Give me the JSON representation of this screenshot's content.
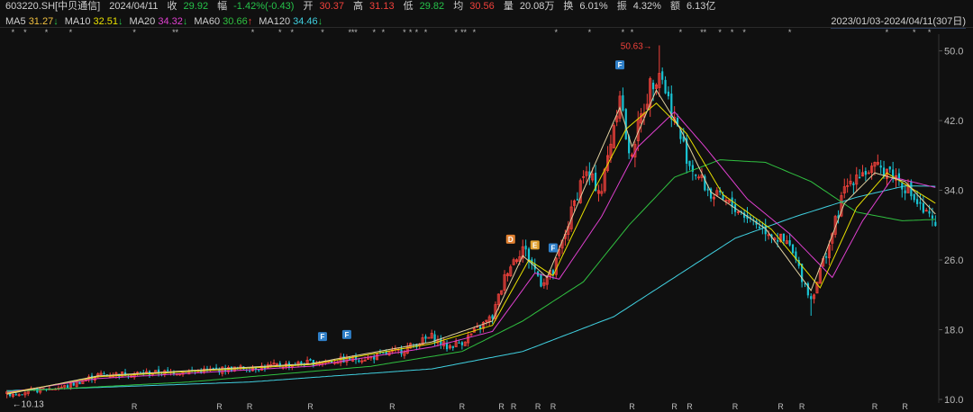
{
  "header": {
    "symbol": "603220.SH[中贝通信]",
    "date": "2024/04/11",
    "close_label": "收",
    "close": "29.92",
    "change_label": "幅",
    "change": "-1.42%(-0.43)",
    "open_label": "开",
    "open": "30.37",
    "high_label": "高",
    "high": "31.13",
    "low_label": "低",
    "low": "29.82",
    "avg_label": "均",
    "avg": "30.56",
    "vol_label": "量",
    "vol": "20.08万",
    "turn_label": "换",
    "turn": "6.01%",
    "amp_label": "振",
    "amp": "4.32%",
    "amt_label": "额",
    "amt": "6.13亿"
  },
  "ma_legend": [
    {
      "label": "MA5",
      "value": "31.27",
      "arrow": "↓",
      "color": "#f0c040"
    },
    {
      "label": "MA10",
      "value": "32.51",
      "arrow": "↓",
      "color": "#e8e000"
    },
    {
      "label": "MA20",
      "value": "34.32",
      "arrow": "↓",
      "color": "#e040d0"
    },
    {
      "label": "MA60",
      "value": "30.66",
      "arrow": "↑",
      "color": "#30c040"
    },
    {
      "label": "MA120",
      "value": "34.46",
      "arrow": "↓",
      "color": "#40d0e0"
    }
  ],
  "date_range": "2023/01/03-2024/04/11(307日)",
  "colors": {
    "up": "#f0413b",
    "down": "#19c3d3",
    "ma5": "#e0d0a0",
    "ma10": "#e8e000",
    "ma20": "#e040d0",
    "ma60": "#30c040",
    "ma120": "#40d0e0"
  },
  "chart_data": {
    "type": "candlestick",
    "ylim": [
      10,
      51.5
    ],
    "yticks": [
      "50.0",
      "42.0",
      "34.0",
      "26.0",
      "18.0",
      "10.0"
    ],
    "ytick_values": [
      50,
      42,
      34,
      26,
      18,
      10
    ],
    "max_label": "50.63",
    "min_label": "10.13",
    "anchors": [
      [
        0,
        10.6
      ],
      [
        20,
        11.5
      ],
      [
        30,
        12.8
      ],
      [
        60,
        13.2
      ],
      [
        80,
        13.6
      ],
      [
        100,
        14.2
      ],
      [
        120,
        14.8
      ],
      [
        130,
        15.6
      ],
      [
        140,
        17.2
      ],
      [
        145,
        16.0
      ],
      [
        150,
        16.6
      ],
      [
        160,
        19.5
      ],
      [
        165,
        25.0
      ],
      [
        170,
        27.5
      ],
      [
        176,
        23.5
      ],
      [
        180,
        24.5
      ],
      [
        190,
        36.0
      ],
      [
        196,
        34.0
      ],
      [
        202,
        45.5
      ],
      [
        205,
        37.5
      ],
      [
        212,
        46.0
      ],
      [
        215,
        48.0
      ],
      [
        220,
        42.0
      ],
      [
        225,
        37.0
      ],
      [
        232,
        33.5
      ],
      [
        240,
        32.0
      ],
      [
        250,
        29.5
      ],
      [
        258,
        27.5
      ],
      [
        265,
        21.5
      ],
      [
        272,
        29.0
      ],
      [
        276,
        34.0
      ],
      [
        280,
        36.0
      ],
      [
        290,
        36.5
      ],
      [
        296,
        34.5
      ],
      [
        302,
        31.5
      ],
      [
        306,
        29.92
      ]
    ],
    "ma_anchors": {
      "ma5": [
        [
          0,
          10.6
        ],
        [
          30,
          12.7
        ],
        [
          100,
          14.1
        ],
        [
          140,
          16.6
        ],
        [
          160,
          19.0
        ],
        [
          170,
          26.5
        ],
        [
          178,
          24.0
        ],
        [
          190,
          34.0
        ],
        [
          202,
          43.5
        ],
        [
          206,
          39.0
        ],
        [
          214,
          45.5
        ],
        [
          222,
          41.0
        ],
        [
          232,
          33.8
        ],
        [
          250,
          29.6
        ],
        [
          265,
          22.5
        ],
        [
          276,
          32.5
        ],
        [
          286,
          36.0
        ],
        [
          296,
          35.0
        ],
        [
          306,
          31.27
        ]
      ],
      "ma10": [
        [
          0,
          10.7
        ],
        [
          30,
          12.6
        ],
        [
          100,
          14.0
        ],
        [
          140,
          16.4
        ],
        [
          160,
          18.5
        ],
        [
          172,
          26.0
        ],
        [
          180,
          24.2
        ],
        [
          192,
          33.0
        ],
        [
          204,
          41.0
        ],
        [
          214,
          44.0
        ],
        [
          224,
          40.5
        ],
        [
          236,
          33.5
        ],
        [
          252,
          29.5
        ],
        [
          268,
          22.8
        ],
        [
          280,
          32.0
        ],
        [
          290,
          36.0
        ],
        [
          306,
          32.51
        ]
      ],
      "ma20": [
        [
          0,
          10.8
        ],
        [
          30,
          12.4
        ],
        [
          100,
          13.8
        ],
        [
          140,
          16.0
        ],
        [
          160,
          17.8
        ],
        [
          174,
          24.5
        ],
        [
          182,
          23.8
        ],
        [
          196,
          31.0
        ],
        [
          208,
          39.0
        ],
        [
          220,
          43.0
        ],
        [
          230,
          39.0
        ],
        [
          244,
          33.0
        ],
        [
          258,
          29.0
        ],
        [
          272,
          24.0
        ],
        [
          282,
          30.5
        ],
        [
          292,
          35.5
        ],
        [
          306,
          34.32
        ]
      ],
      "ma60": [
        [
          0,
          10.9
        ],
        [
          60,
          12.0
        ],
        [
          120,
          13.8
        ],
        [
          150,
          15.5
        ],
        [
          170,
          19.0
        ],
        [
          190,
          23.5
        ],
        [
          205,
          30.0
        ],
        [
          220,
          35.5
        ],
        [
          235,
          37.5
        ],
        [
          250,
          37.2
        ],
        [
          265,
          35.0
        ],
        [
          280,
          31.5
        ],
        [
          295,
          30.5
        ],
        [
          306,
          30.66
        ]
      ],
      "ma120": [
        [
          0,
          11.0
        ],
        [
          80,
          12.0
        ],
        [
          140,
          13.5
        ],
        [
          170,
          15.5
        ],
        [
          200,
          19.5
        ],
        [
          220,
          24.0
        ],
        [
          240,
          28.5
        ],
        [
          260,
          31.0
        ],
        [
          280,
          33.2
        ],
        [
          296,
          34.5
        ],
        [
          306,
          34.46
        ]
      ]
    },
    "badges": [
      {
        "index": 104,
        "label": "F",
        "color": "#2f7fc8"
      },
      {
        "index": 112,
        "label": "F",
        "color": "#2f7fc8"
      },
      {
        "index": 166,
        "label": "D",
        "color": "#e08030"
      },
      {
        "index": 174,
        "label": "E",
        "color": "#e0a030"
      },
      {
        "index": 180,
        "label": "F",
        "color": "#2f7fc8"
      },
      {
        "index": 202,
        "label": "F",
        "color": "#2f7fc8"
      }
    ],
    "bottom_markers": [
      "R",
      "R",
      "R",
      "R",
      "R",
      "R",
      "R",
      "R",
      "R",
      "R",
      "R",
      "R",
      "R",
      "R",
      "R",
      "R",
      "R",
      "R",
      "R",
      "R",
      "R",
      "R",
      "R",
      "R",
      "R"
    ]
  }
}
